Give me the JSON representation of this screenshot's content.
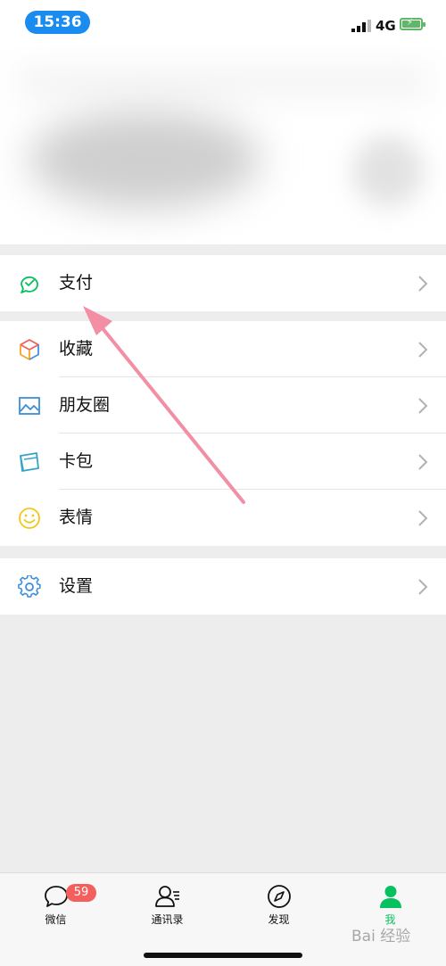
{
  "status_bar": {
    "time": "15:36",
    "network": "4G"
  },
  "menu": {
    "pay": {
      "label": "支付",
      "icon": "wallet-icon"
    },
    "favorites": {
      "label": "收藏",
      "icon": "cube-icon"
    },
    "moments": {
      "label": "朋友圈",
      "icon": "picture-icon"
    },
    "cards": {
      "label": "卡包",
      "icon": "card-icon"
    },
    "stickers": {
      "label": "表情",
      "icon": "smiley-icon"
    },
    "settings": {
      "label": "设置",
      "icon": "gear-icon"
    }
  },
  "tabbar": {
    "chats": {
      "label": "微信",
      "badge": "59"
    },
    "contacts": {
      "label": "通讯录"
    },
    "discover": {
      "label": "发现"
    },
    "me": {
      "label": "我"
    }
  },
  "colors": {
    "accent": "#07c160",
    "badge": "#f25f5c",
    "time_pill": "#1a8cf0",
    "arrow": "#f38fa4"
  },
  "watermark": "Bai 经验"
}
